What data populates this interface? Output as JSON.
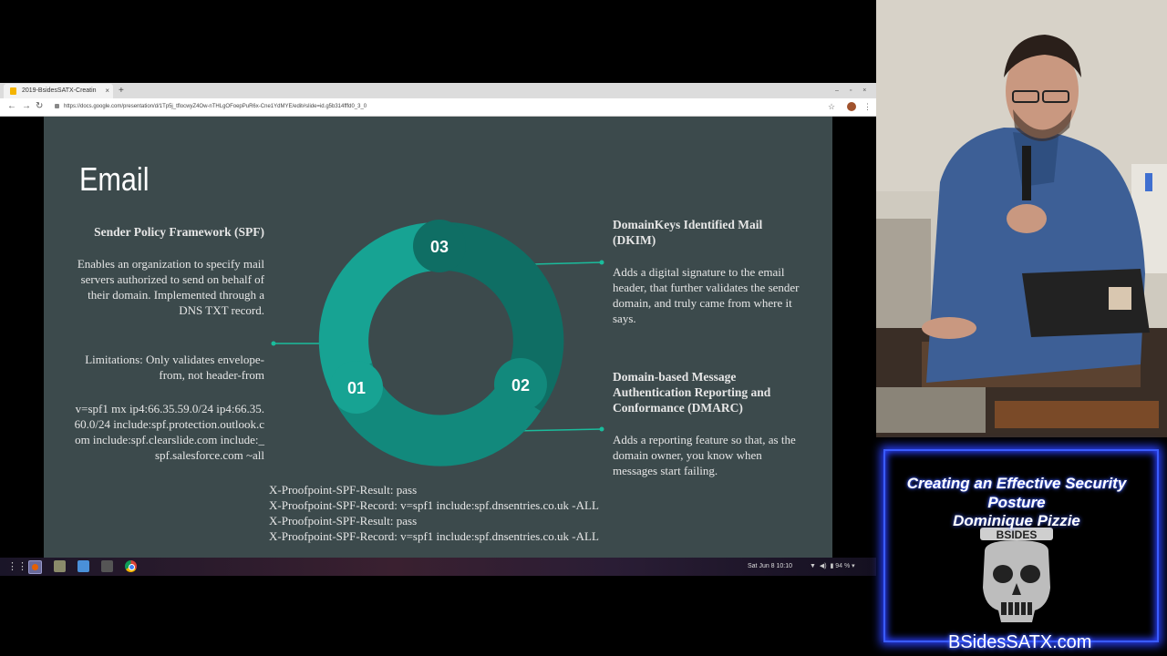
{
  "browser": {
    "tab_title": "2019-BsidesSATX-Creatin",
    "tab_close": "×",
    "new_tab": "+",
    "window_controls": "– ▫ ×",
    "url": "https://docs.google.com/presentation/d/1Tp5j_tflocwyZ4Ow-nTHLgOFoepPuR6x-Cne1YdMYE/edit#slide=id.g5b314fffd0_3_0"
  },
  "slide": {
    "title": "Email",
    "spf_heading": "Sender Policy Framework (SPF)",
    "spf_description": "Enables an organization to specify mail servers authorized to send on behalf of their domain. Implemented through a DNS TXT record.",
    "spf_limitations": "Limitations: Only validates envelope-from, not header-from",
    "spf_record": "v=spf1 mx ip4:66.35.59.0/24 ip4:66.35.60.0/24 include:spf.protection.outlook.com include:spf.clearslide.com include:_spf.salesforce.com ~all",
    "header_lines": [
      "X-Proofpoint-SPF-Result: pass",
      "X-Proofpoint-SPF-Record: v=spf1 include:spf.dnsentries.co.uk -ALL",
      "X-Proofpoint-SPF-Result: pass",
      "X-Proofpoint-SPF-Record: v=spf1 include:spf.dnsentries.co.uk -ALL"
    ],
    "dkim_heading": "DomainKeys Identified Mail (DKIM)",
    "dkim_description": "Adds a digital signature to the email header, that further validates the sender domain, and truly came from where it says.",
    "dmarc_heading": "Domain-based Message Authentication Reporting and Conformance (DMARC)",
    "dmarc_description": "Adds a reporting feature so that, as the domain owner, you know when messages start failing.",
    "ring_labels": [
      "01",
      "02",
      "03"
    ],
    "colors": {
      "background": "#3c4a4c",
      "segment_light": "#17a393",
      "segment_mid": "#12897c",
      "segment_dark": "#0f6e64",
      "connector": "#1abc9c"
    }
  },
  "taskbar": {
    "clock": "Sat Jun 8  10:10",
    "battery": "94 %",
    "apps": [
      "apps-grid-icon",
      "firefox-icon",
      "files-icon",
      "bag-icon",
      "terminal-icon",
      "chrome-icon"
    ]
  },
  "overlay": {
    "talk_title": "Creating an Effective Security Posture",
    "speaker": "Dominique Pizzie",
    "logo_text": "BSIDES",
    "site": "BSidesSATX.com"
  }
}
